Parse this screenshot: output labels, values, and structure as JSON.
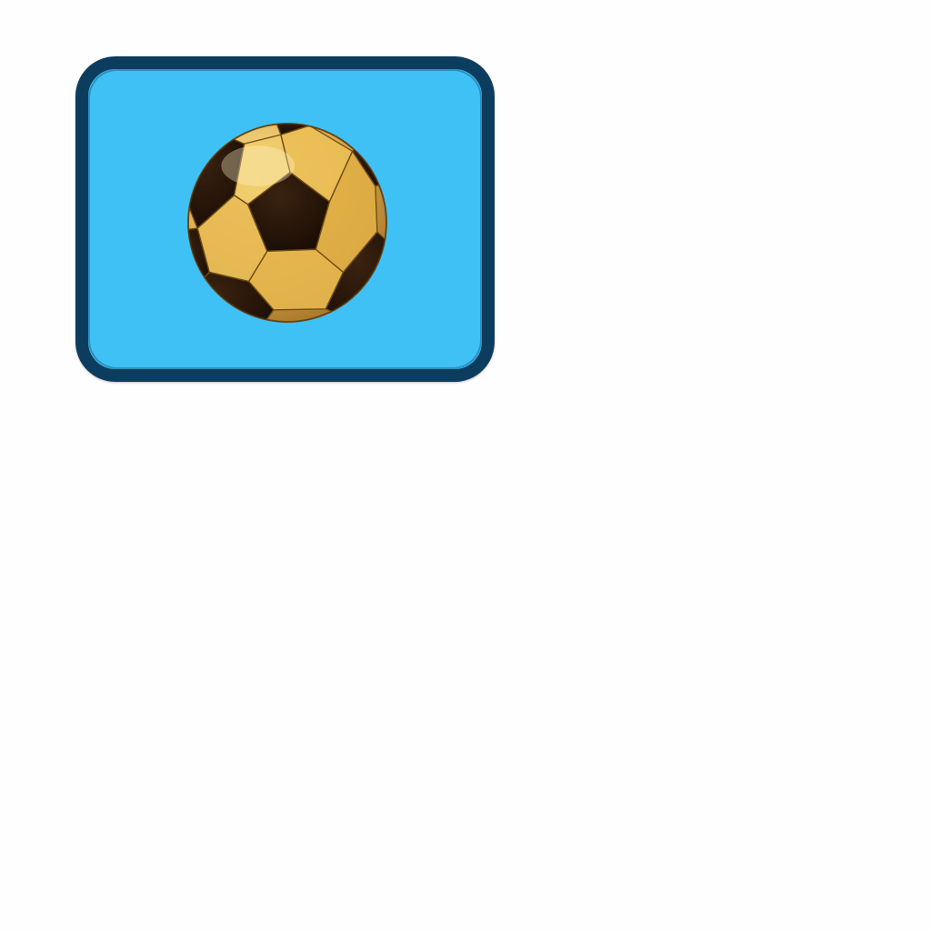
{
  "card": {
    "background_color": "#40c1f5",
    "border_color": "#0d3d5e"
  },
  "ball": {
    "icon": "soccer-ball-icon",
    "panel_light": "#f2cf71",
    "panel_mid": "#d9a641",
    "panel_dark_edge": "#a8752a",
    "patch_color": "#1d0f05"
  }
}
